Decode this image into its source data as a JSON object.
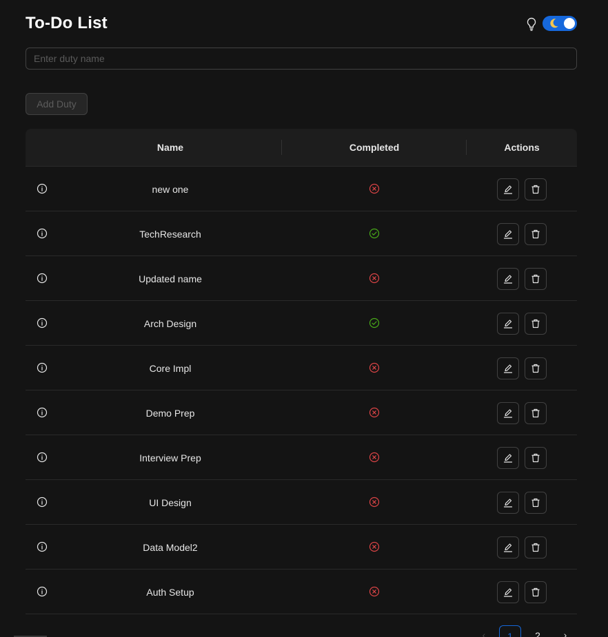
{
  "header": {
    "title": "To-Do List"
  },
  "theme_toggle": {
    "on": true,
    "accent": "#1668dc"
  },
  "duty_input": {
    "value": "",
    "placeholder": "Enter duty name"
  },
  "add_button": {
    "label": "Add Duty",
    "disabled": true
  },
  "table": {
    "columns": [
      "Name",
      "Completed",
      "Actions"
    ],
    "rows": [
      {
        "name": "new one",
        "completed": false
      },
      {
        "name": "TechResearch",
        "completed": true
      },
      {
        "name": "Updated name",
        "completed": false
      },
      {
        "name": "Arch Design",
        "completed": true
      },
      {
        "name": "Core Impl",
        "completed": false
      },
      {
        "name": "Demo Prep",
        "completed": false
      },
      {
        "name": "Interview Prep",
        "completed": false
      },
      {
        "name": "UI Design",
        "completed": false
      },
      {
        "name": "Data Model2",
        "completed": false
      },
      {
        "name": "Auth Setup",
        "completed": false
      }
    ]
  },
  "pagination": {
    "current": "1",
    "pages": [
      "1",
      "2"
    ]
  },
  "colors": {
    "success": "#49aa19",
    "error": "#dc4446",
    "accent": "#1668dc"
  },
  "icons": {
    "info": "info-circle-icon",
    "completed_true": "check-circle-icon",
    "completed_false": "close-circle-icon",
    "edit": "edit-icon",
    "delete": "delete-icon",
    "bulb": "bulb-icon",
    "moon": "moon-icon"
  }
}
